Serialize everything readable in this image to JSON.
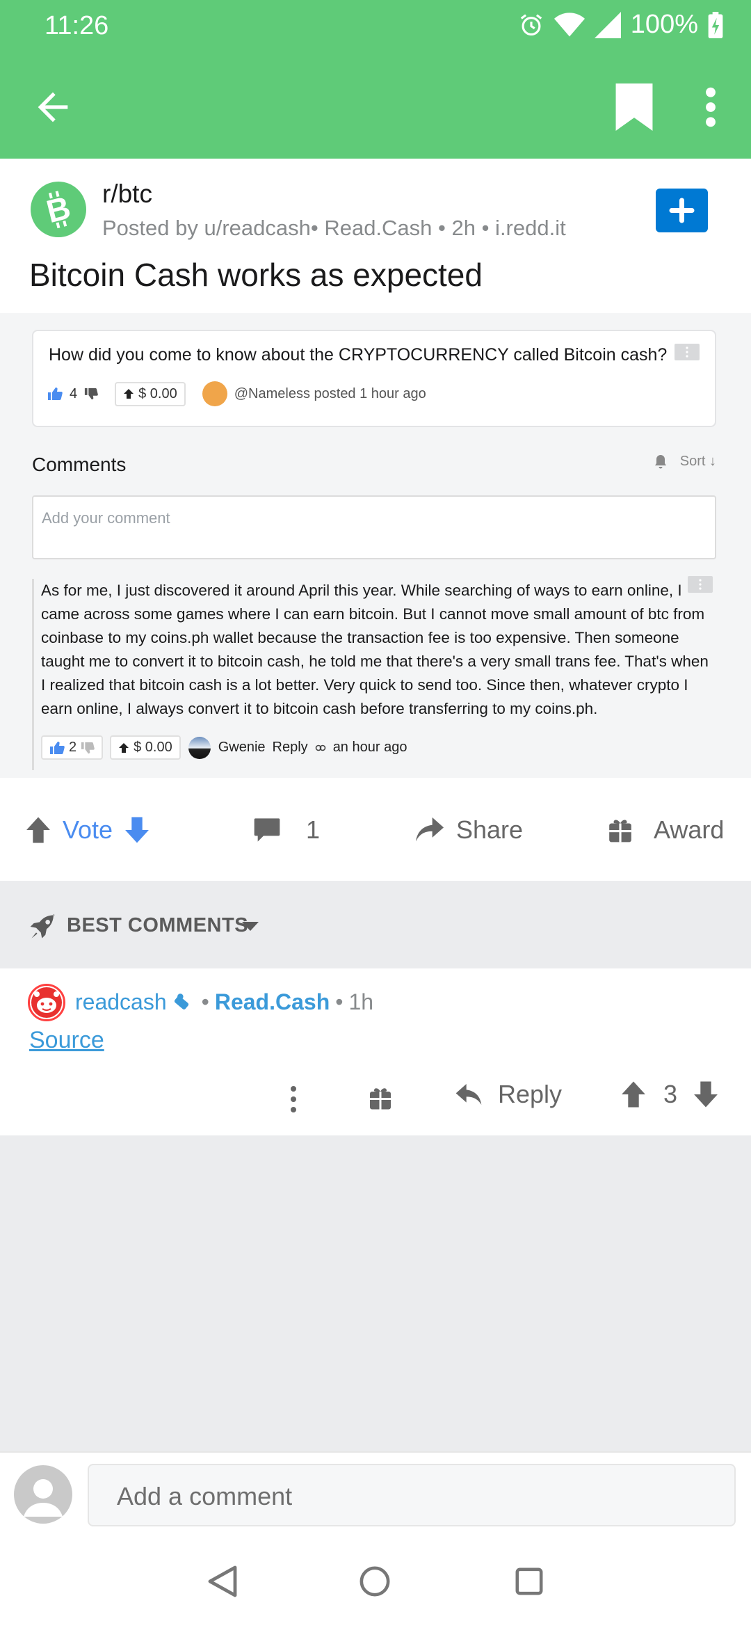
{
  "status_bar": {
    "time": "11:26",
    "battery": "100%"
  },
  "post": {
    "subreddit": "r/btc",
    "meta": "Posted by u/readcash• Read.Cash • 2h • i.redd.it",
    "title": "Bitcoin Cash works as expected"
  },
  "embed": {
    "question": "How did you come to know about the CRYPTOCURRENCY called Bitcoin cash?",
    "question_likes": "4",
    "question_tip": "$ 0.00",
    "question_meta": "@Nameless posted 1 hour ago",
    "comments_title": "Comments",
    "sort_label": "Sort ↓",
    "comment_placeholder": "Add your comment",
    "comment_text": "As for me, I just discovered it around April this year. While searching of ways to earn online, I came across some games where I can earn bitcoin. But I cannot move small amount of btc from coinbase to my coins.ph wallet because the transaction fee is too expensive. Then someone taught me to convert it to bitcoin cash, he told me that there's a very small trans fee. That's when I realized that bitcoin cash is a lot better. Very quick to send too. Since then, whatever crypto I earn online, I always convert it to bitcoin cash before transferring to my coins.ph.",
    "comment_likes": "2",
    "comment_tip": "$ 0.00",
    "comment_user": "Gwenie",
    "comment_reply": "Reply",
    "comment_time": "an hour ago"
  },
  "actions": {
    "vote": "Vote",
    "comments": "1",
    "share": "Share",
    "award": "Award"
  },
  "best_comments": {
    "label": "BEST COMMENTS",
    "user": "readcash",
    "domain": "Read.Cash",
    "time": "1h",
    "link": "Source",
    "reply": "Reply",
    "score": "3"
  },
  "composer": {
    "placeholder": "Add a comment"
  },
  "colors": {
    "appbar": "#5fcb78",
    "link": "#3b9ad9",
    "vote": "#4a8cf0",
    "join": "#0079d3"
  }
}
